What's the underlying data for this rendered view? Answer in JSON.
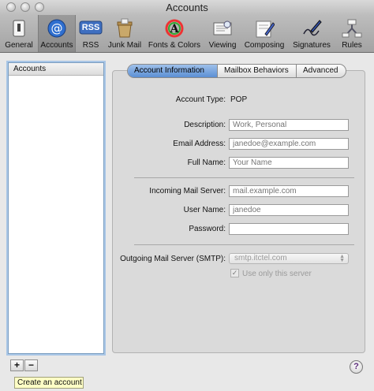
{
  "window": {
    "title": "Accounts"
  },
  "toolbar": {
    "items": [
      {
        "label": "General",
        "icon": "switch-icon"
      },
      {
        "label": "Accounts",
        "icon": "at-sign-icon"
      },
      {
        "label": "RSS",
        "icon": "rss-icon"
      },
      {
        "label": "Junk Mail",
        "icon": "junk-mail-icon"
      },
      {
        "label": "Fonts & Colors",
        "icon": "fonts-colors-icon"
      },
      {
        "label": "Viewing",
        "icon": "viewing-icon"
      },
      {
        "label": "Composing",
        "icon": "composing-icon"
      },
      {
        "label": "Signatures",
        "icon": "signatures-icon"
      },
      {
        "label": "Rules",
        "icon": "rules-icon"
      }
    ],
    "selected": "Accounts",
    "rss_badge": "RSS"
  },
  "sidebar": {
    "header": "Accounts",
    "add_label": "+",
    "remove_label": "−",
    "tooltip": "Create an account"
  },
  "tabs": [
    {
      "label": "Account Information",
      "active": true
    },
    {
      "label": "Mailbox Behaviors",
      "active": false
    },
    {
      "label": "Advanced",
      "active": false
    }
  ],
  "form": {
    "account_type_label": "Account Type:",
    "account_type_value": "POP",
    "description_label": "Description:",
    "description_placeholder": "Work, Personal",
    "email_label": "Email Address:",
    "email_placeholder": "janedoe@example.com",
    "fullname_label": "Full Name:",
    "fullname_placeholder": "Your Name",
    "incoming_label": "Incoming Mail Server:",
    "incoming_placeholder": "mail.example.com",
    "username_label": "User Name:",
    "username_placeholder": "janedoe",
    "password_label": "Password:",
    "smtp_label": "Outgoing Mail Server (SMTP):",
    "smtp_value": "smtp.itctel.com",
    "only_server_label": "Use only this server",
    "only_server_checked": true
  },
  "help": {
    "label": "?"
  },
  "colors": {
    "selection_blue": "#5b8fd4",
    "tooltip_bg": "#ffffc6"
  }
}
